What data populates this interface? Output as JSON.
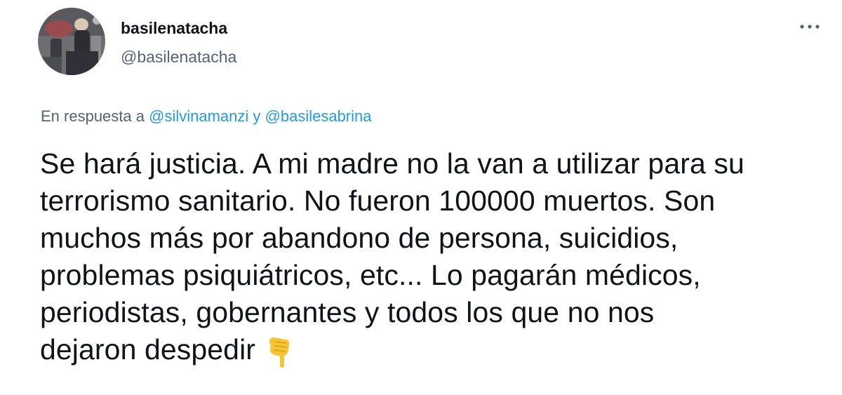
{
  "tweet": {
    "author": {
      "display_name": "basilenatacha",
      "handle": "@basilenatacha",
      "avatar_icon": "profile-photo"
    },
    "more_icon": "more-options-icon",
    "reply_to": {
      "prefix": "En respuesta a",
      "mention_1": "@silvinamanzi",
      "conjunction": "y",
      "mention_2": "@basilesabrina"
    },
    "body_lines": [
      "Se hará justicia. A mi madre no la van a utilizar para su",
      "terrorismo sanitario. No fueron 100000 muertos. Son",
      "muchos más por abandono de persona, suicidios,",
      "problemas psiquiátricos, etc... Lo pagarán médicos,",
      "periodistas, gobernantes y todos los que no nos",
      "dejaron despedir"
    ],
    "trailing_emoji": "backhand-index-pointing-down",
    "colors": {
      "text": "#0f1419",
      "secondary": "#536471",
      "link": "#1d9bf0"
    }
  }
}
